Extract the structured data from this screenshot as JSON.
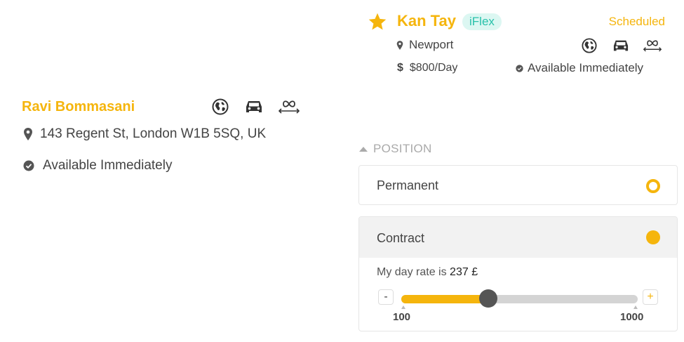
{
  "candidate_left": {
    "name": "Ravi Bommasani",
    "address": "143 Regent St, London W1B 5SQ, UK",
    "availability": "Available Immediately",
    "icons": [
      "globe-icon",
      "car-icon",
      "infinity-commute-icon",
      "location-pin-icon",
      "check-circle-icon"
    ]
  },
  "candidate_right": {
    "name": "Kan Tay",
    "badge": "iFlex",
    "status": "Scheduled",
    "location": "Newport",
    "currency_symbol": "$",
    "rate": "$800/Day",
    "availability": "Available Immediately",
    "icons": [
      "star-icon",
      "location-pin-icon",
      "dollar-icon",
      "globe-icon",
      "car-icon",
      "infinity-commute-icon",
      "check-circle-icon"
    ]
  },
  "position": {
    "title": "POSITION",
    "options": [
      {
        "label": "Permanent",
        "selected": false
      },
      {
        "label": "Contract",
        "selected": true
      }
    ],
    "day_rate_label": "My day rate is",
    "day_rate_value": "237 £",
    "slider": {
      "min": 100,
      "max": 1000,
      "value": 430,
      "min_label": "100",
      "max_label": "1000",
      "minus": "-",
      "plus": "+"
    }
  },
  "colors": {
    "accent": "#f5b50d",
    "badge_bg": "#dcf7f2",
    "badge_text": "#29c1aa",
    "text": "#444444",
    "muted": "#aaaaaa",
    "selected_row_bg": "#f2f2f2"
  }
}
